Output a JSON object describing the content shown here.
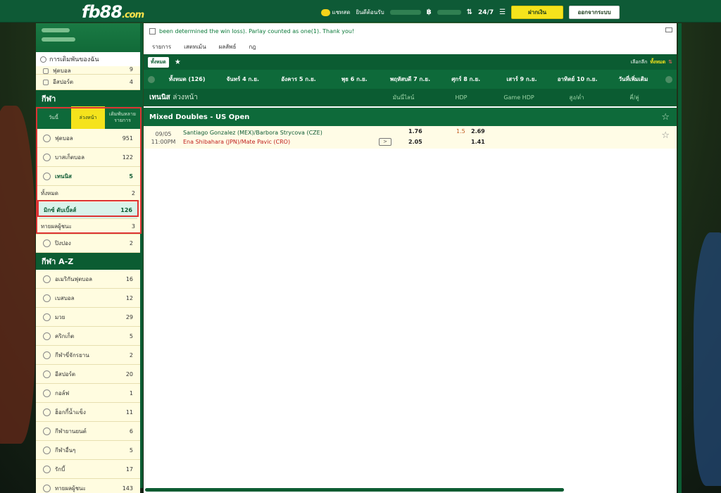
{
  "topbar": {
    "logo_main": "fb88",
    "logo_suffix": ".com",
    "chat_label": "แชทสด",
    "welcome_label": "ยินดีต้อนรับ",
    "deposit_button": "ฝากเงิน",
    "logout_button": "ออกจากระบบ"
  },
  "sidebar": {
    "my_bets_label": "การเดิมพันของฉัน",
    "pre_rows": [
      {
        "label": "ฟุตบอล",
        "count": "9"
      },
      {
        "label": "อีสปอร์ต",
        "count": "4"
      }
    ],
    "sports_header": "กีฬา",
    "tabs": [
      "วันนี้",
      "ล่วงหน้า",
      "เดิมพันหลายรายการ"
    ],
    "sports": [
      {
        "label": "ฟุตบอล",
        "count": "951"
      },
      {
        "label": "บาสเก็ตบอล",
        "count": "122"
      },
      {
        "label": "เทนนิส",
        "count": "5"
      }
    ],
    "tennis_subs": [
      {
        "label": "ทั้งหมด",
        "count": "2"
      },
      {
        "label": "มิกซ์ ดับเบิ้ลส์",
        "count": "126"
      },
      {
        "label": "ทายผลผู้ชนะ",
        "count": "3"
      }
    ],
    "after_rows": [
      {
        "label": "ปิงปอง",
        "count": "2"
      }
    ],
    "az_header": "กีฬา A-Z",
    "az_rows": [
      {
        "label": "อเมริกันฟุตบอล",
        "count": "16"
      },
      {
        "label": "เบสบอล",
        "count": "12"
      },
      {
        "label": "มวย",
        "count": "29"
      },
      {
        "label": "คริกเก็ต",
        "count": "5"
      },
      {
        "label": "กีฬาขี่จักรยาน",
        "count": "2"
      },
      {
        "label": "อีสปอร์ต",
        "count": "20"
      },
      {
        "label": "กอล์ฟ",
        "count": "1"
      },
      {
        "label": "ฮ็อกกี้น้ำแข็ง",
        "count": "11"
      },
      {
        "label": "กีฬายานยนต์",
        "count": "6"
      },
      {
        "label": "กีฬาอื่นๆ",
        "count": "5"
      },
      {
        "label": "รักบี้",
        "count": "17"
      },
      {
        "label": "ทายผลผู้ชนะ",
        "count": "143"
      }
    ]
  },
  "main": {
    "news_text": "been determined the win loss). Parlay counted as one(1). Thank you!",
    "menu": [
      "รายการ",
      "เสตทเม้น",
      "ผลลัพธ์",
      "กฎ"
    ],
    "filter_chip": "ทั้งหมด",
    "select_label": "เลือกลีก",
    "select_value": "ทั้งหมด",
    "dates": [
      "ทั้งหมด (126)",
      "จันทร์ 4 ก.ย.",
      "อังคาร 5 ก.ย.",
      "พุธ 6 ก.ย.",
      "พฤหัสบดี 7 ก.ย.",
      "ศุกร์ 8 ก.ย.",
      "เสาร์ 9 ก.ย.",
      "อาทิตย์ 10 ก.ย.",
      "วันที่เพิ่มเติม"
    ],
    "section_title": "เทนนิส",
    "section_sub": "ล่วงหน้า",
    "columns": [
      "มันนี่ไลน์",
      "HDP",
      "Game HDP",
      "สูง/ต่ำ",
      "คี่/คู่"
    ],
    "league": "Mixed Doubles - US Open",
    "match": {
      "date": "09/05",
      "time": "11:00PM",
      "team1": "Santiago Gonzalez (MEX)/Barbora Strycova (CZE)",
      "team2": "Ena Shibahara (JPN)/Mate Pavic (CRO)",
      "ml1": "1.76",
      "ml2": "2.05",
      "hdp_line": "1.5",
      "hdp1": "2.69",
      "hdp2": "1.41"
    }
  }
}
